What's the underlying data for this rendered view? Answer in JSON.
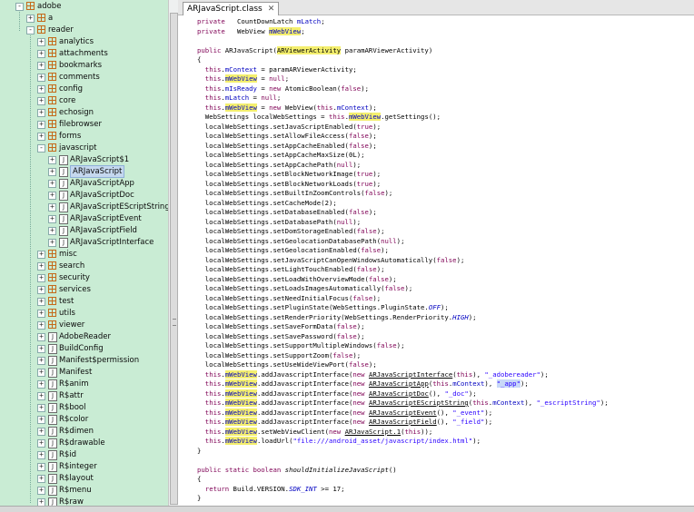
{
  "tree": {
    "items": [
      {
        "label": "adobe",
        "type": "pkg",
        "level": 0,
        "exp": "-"
      },
      {
        "label": "a",
        "type": "pkg",
        "level": 1,
        "exp": "+"
      },
      {
        "label": "reader",
        "type": "pkg",
        "level": 1,
        "exp": "-"
      },
      {
        "label": "analytics",
        "type": "pkg",
        "level": 2,
        "exp": "+"
      },
      {
        "label": "attachments",
        "type": "pkg",
        "level": 2,
        "exp": "+"
      },
      {
        "label": "bookmarks",
        "type": "pkg",
        "level": 2,
        "exp": "+"
      },
      {
        "label": "comments",
        "type": "pkg",
        "level": 2,
        "exp": "+"
      },
      {
        "label": "config",
        "type": "pkg",
        "level": 2,
        "exp": "+"
      },
      {
        "label": "core",
        "type": "pkg",
        "level": 2,
        "exp": "+"
      },
      {
        "label": "echosign",
        "type": "pkg",
        "level": 2,
        "exp": "+"
      },
      {
        "label": "filebrowser",
        "type": "pkg",
        "level": 2,
        "exp": "+"
      },
      {
        "label": "forms",
        "type": "pkg",
        "level": 2,
        "exp": "+"
      },
      {
        "label": "javascript",
        "type": "pkg",
        "level": 2,
        "exp": "-"
      },
      {
        "label": "ARJavaScript$1",
        "type": "cls",
        "level": 3,
        "exp": "+"
      },
      {
        "label": "ARJavaScript",
        "type": "cls",
        "level": 3,
        "exp": "+",
        "selected": true
      },
      {
        "label": "ARJavaScriptApp",
        "type": "cls",
        "level": 3,
        "exp": "+"
      },
      {
        "label": "ARJavaScriptDoc",
        "type": "cls",
        "level": 3,
        "exp": "+"
      },
      {
        "label": "ARJavaScriptEScriptString",
        "type": "cls",
        "level": 3,
        "exp": "+"
      },
      {
        "label": "ARJavaScriptEvent",
        "type": "cls",
        "level": 3,
        "exp": "+"
      },
      {
        "label": "ARJavaScriptField",
        "type": "cls",
        "level": 3,
        "exp": "+"
      },
      {
        "label": "ARJavaScriptInterface",
        "type": "cls",
        "level": 3,
        "exp": "+"
      },
      {
        "label": "misc",
        "type": "pkg",
        "level": 2,
        "exp": "+"
      },
      {
        "label": "search",
        "type": "pkg",
        "level": 2,
        "exp": "+"
      },
      {
        "label": "security",
        "type": "pkg",
        "level": 2,
        "exp": "+"
      },
      {
        "label": "services",
        "type": "pkg",
        "level": 2,
        "exp": "+"
      },
      {
        "label": "test",
        "type": "pkg",
        "level": 2,
        "exp": "+"
      },
      {
        "label": "utils",
        "type": "pkg",
        "level": 2,
        "exp": "+"
      },
      {
        "label": "viewer",
        "type": "pkg",
        "level": 2,
        "exp": "+"
      },
      {
        "label": "AdobeReader",
        "type": "cls",
        "level": 2,
        "exp": "+"
      },
      {
        "label": "BuildConfig",
        "type": "cls",
        "level": 2,
        "exp": "+"
      },
      {
        "label": "Manifest$permission",
        "type": "cls",
        "level": 2,
        "exp": "+"
      },
      {
        "label": "Manifest",
        "type": "cls",
        "level": 2,
        "exp": "+"
      },
      {
        "label": "R$anim",
        "type": "cls",
        "level": 2,
        "exp": "+"
      },
      {
        "label": "R$attr",
        "type": "cls",
        "level": 2,
        "exp": "+"
      },
      {
        "label": "R$bool",
        "type": "cls",
        "level": 2,
        "exp": "+"
      },
      {
        "label": "R$color",
        "type": "cls",
        "level": 2,
        "exp": "+"
      },
      {
        "label": "R$dimen",
        "type": "cls",
        "level": 2,
        "exp": "+"
      },
      {
        "label": "R$drawable",
        "type": "cls",
        "level": 2,
        "exp": "+"
      },
      {
        "label": "R$id",
        "type": "cls",
        "level": 2,
        "exp": "+"
      },
      {
        "label": "R$integer",
        "type": "cls",
        "level": 2,
        "exp": "+"
      },
      {
        "label": "R$layout",
        "type": "cls",
        "level": 2,
        "exp": "+"
      },
      {
        "label": "R$menu",
        "type": "cls",
        "level": 2,
        "exp": "+"
      },
      {
        "label": "R$raw",
        "type": "cls",
        "level": 2,
        "exp": "+"
      }
    ]
  },
  "editor": {
    "tab_title": "ARJavaScript.class",
    "close_glyph": "✕",
    "lines": [
      [
        [
          "kw",
          "private"
        ],
        [
          "",
          "   CountDownLatch "
        ],
        [
          "fld",
          "mLatch"
        ],
        [
          "",
          ";"
        ]
      ],
      [
        [
          "kw",
          "private"
        ],
        [
          "",
          "   WebView "
        ],
        [
          "fld hl",
          "mWebView"
        ],
        [
          "",
          ";"
        ]
      ],
      [],
      [
        [
          "kw",
          "public"
        ],
        [
          "",
          " ARJavaScript("
        ],
        [
          "hl",
          "ARViewerActivity"
        ],
        [
          "",
          " paramARViewerActivity)"
        ]
      ],
      [
        [
          "",
          "{"
        ]
      ],
      [
        [
          "",
          "  "
        ],
        [
          "kw",
          "this"
        ],
        [
          "",
          "."
        ],
        [
          "fld",
          "mContext"
        ],
        [
          "",
          " = paramARViewerActivity;"
        ]
      ],
      [
        [
          "",
          "  "
        ],
        [
          "kw",
          "this"
        ],
        [
          "",
          "."
        ],
        [
          "fld hl",
          "mWebView"
        ],
        [
          "",
          " = "
        ],
        [
          "kw",
          "null"
        ],
        [
          "",
          ";"
        ]
      ],
      [
        [
          "",
          "  "
        ],
        [
          "kw",
          "this"
        ],
        [
          "",
          "."
        ],
        [
          "fld",
          "mIsReady"
        ],
        [
          "",
          " = "
        ],
        [
          "kw",
          "new"
        ],
        [
          "",
          " AtomicBoolean("
        ],
        [
          "kw",
          "false"
        ],
        [
          "",
          ");"
        ]
      ],
      [
        [
          "",
          "  "
        ],
        [
          "kw",
          "this"
        ],
        [
          "",
          "."
        ],
        [
          "fld",
          "mLatch"
        ],
        [
          "",
          " = "
        ],
        [
          "kw",
          "null"
        ],
        [
          "",
          ";"
        ]
      ],
      [
        [
          "",
          "  "
        ],
        [
          "kw",
          "this"
        ],
        [
          "",
          "."
        ],
        [
          "fld hl",
          "mWebView"
        ],
        [
          "",
          " = "
        ],
        [
          "kw",
          "new"
        ],
        [
          "",
          " WebView("
        ],
        [
          "kw",
          "this"
        ],
        [
          "",
          "."
        ],
        [
          "fld",
          "mContext"
        ],
        [
          "",
          ");"
        ]
      ],
      [
        [
          "",
          "  WebSettings localWebSettings = "
        ],
        [
          "kw",
          "this"
        ],
        [
          "",
          "."
        ],
        [
          "fld hl",
          "mWebView"
        ],
        [
          "",
          ".getSettings();"
        ]
      ],
      [
        [
          "",
          "  localWebSettings.setJavaScriptEnabled("
        ],
        [
          "kw",
          "true"
        ],
        [
          "",
          ");"
        ]
      ],
      [
        [
          "",
          "  localWebSettings.setAllowFileAccess("
        ],
        [
          "kw",
          "false"
        ],
        [
          "",
          ");"
        ]
      ],
      [
        [
          "",
          "  localWebSettings.setAppCacheEnabled("
        ],
        [
          "kw",
          "false"
        ],
        [
          "",
          ");"
        ]
      ],
      [
        [
          "",
          "  localWebSettings.setAppCacheMaxSize(0L);"
        ]
      ],
      [
        [
          "",
          "  localWebSettings.setAppCachePath("
        ],
        [
          "kw",
          "null"
        ],
        [
          "",
          ");"
        ]
      ],
      [
        [
          "",
          "  localWebSettings.setBlockNetworkImage("
        ],
        [
          "kw",
          "true"
        ],
        [
          "",
          ");"
        ]
      ],
      [
        [
          "",
          "  localWebSettings.setBlockNetworkLoads("
        ],
        [
          "kw",
          "true"
        ],
        [
          "",
          ");"
        ]
      ],
      [
        [
          "",
          "  localWebSettings.setBuiltInZoomControls("
        ],
        [
          "kw",
          "false"
        ],
        [
          "",
          ");"
        ]
      ],
      [
        [
          "",
          "  localWebSettings.setCacheMode(2);"
        ]
      ],
      [
        [
          "",
          "  localWebSettings.setDatabaseEnabled("
        ],
        [
          "kw",
          "false"
        ],
        [
          "",
          ");"
        ]
      ],
      [
        [
          "",
          "  localWebSettings.setDatabasePath("
        ],
        [
          "kw",
          "null"
        ],
        [
          "",
          ");"
        ]
      ],
      [
        [
          "",
          "  localWebSettings.setDomStorageEnabled("
        ],
        [
          "kw",
          "false"
        ],
        [
          "",
          ");"
        ]
      ],
      [
        [
          "",
          "  localWebSettings.setGeolocationDatabasePath("
        ],
        [
          "kw",
          "null"
        ],
        [
          "",
          ");"
        ]
      ],
      [
        [
          "",
          "  localWebSettings.setGeolocationEnabled("
        ],
        [
          "kw",
          "false"
        ],
        [
          "",
          ");"
        ]
      ],
      [
        [
          "",
          "  localWebSettings.setJavaScriptCanOpenWindowsAutomatically("
        ],
        [
          "kw",
          "false"
        ],
        [
          "",
          ");"
        ]
      ],
      [
        [
          "",
          "  localWebSettings.setLightTouchEnabled("
        ],
        [
          "kw",
          "false"
        ],
        [
          "",
          ");"
        ]
      ],
      [
        [
          "",
          "  localWebSettings.setLoadWithOverviewMode("
        ],
        [
          "kw",
          "false"
        ],
        [
          "",
          ");"
        ]
      ],
      [
        [
          "",
          "  localWebSettings.setLoadsImagesAutomatically("
        ],
        [
          "kw",
          "false"
        ],
        [
          "",
          ");"
        ]
      ],
      [
        [
          "",
          "  localWebSettings.setNeedInitialFocus("
        ],
        [
          "kw",
          "false"
        ],
        [
          "",
          ");"
        ]
      ],
      [
        [
          "",
          "  localWebSettings.setPluginState(WebSettings.PluginState."
        ],
        [
          "sta",
          "OFF"
        ],
        [
          "",
          ");"
        ]
      ],
      [
        [
          "",
          "  localWebSettings.setRenderPriority(WebSettings.RenderPriority."
        ],
        [
          "sta",
          "HIGH"
        ],
        [
          "",
          ");"
        ]
      ],
      [
        [
          "",
          "  localWebSettings.setSaveFormData("
        ],
        [
          "kw",
          "false"
        ],
        [
          "",
          ");"
        ]
      ],
      [
        [
          "",
          "  localWebSettings.setSavePassword("
        ],
        [
          "kw",
          "false"
        ],
        [
          "",
          ");"
        ]
      ],
      [
        [
          "",
          "  localWebSettings.setSupportMultipleWindows("
        ],
        [
          "kw",
          "false"
        ],
        [
          "",
          ");"
        ]
      ],
      [
        [
          "",
          "  localWebSettings.setSupportZoom("
        ],
        [
          "kw",
          "false"
        ],
        [
          "",
          ");"
        ]
      ],
      [
        [
          "",
          "  localWebSettings.setUseWideViewPort("
        ],
        [
          "kw",
          "false"
        ],
        [
          "",
          ");"
        ]
      ],
      [
        [
          "",
          "  "
        ],
        [
          "kw",
          "this"
        ],
        [
          "",
          "."
        ],
        [
          "fld hl",
          "mWebView"
        ],
        [
          "",
          ".addJavascriptInterface("
        ],
        [
          "kw",
          "new"
        ],
        [
          "",
          " "
        ],
        [
          "ul",
          "ARJavaScriptInterface"
        ],
        [
          "",
          "("
        ],
        [
          "kw",
          "this"
        ],
        [
          "",
          "), "
        ],
        [
          "st",
          "\"_adobereader\""
        ],
        [
          "",
          ");"
        ]
      ],
      [
        [
          "",
          "  "
        ],
        [
          "kw",
          "this"
        ],
        [
          "",
          "."
        ],
        [
          "fld hl",
          "mWebView"
        ],
        [
          "",
          ".addJavascriptInterface("
        ],
        [
          "kw",
          "new"
        ],
        [
          "",
          " "
        ],
        [
          "ul",
          "ARJavaScriptApp"
        ],
        [
          "",
          "("
        ],
        [
          "kw",
          "this"
        ],
        [
          "",
          "."
        ],
        [
          "fld",
          "mContext"
        ],
        [
          "",
          "), "
        ],
        [
          "st hlsel",
          "\"_app\""
        ],
        [
          "",
          ");"
        ]
      ],
      [
        [
          "",
          "  "
        ],
        [
          "kw",
          "this"
        ],
        [
          "",
          "."
        ],
        [
          "fld hl",
          "mWebView"
        ],
        [
          "",
          ".addJavascriptInterface("
        ],
        [
          "kw",
          "new"
        ],
        [
          "",
          " "
        ],
        [
          "ul",
          "ARJavaScriptDoc"
        ],
        [
          "",
          "(), "
        ],
        [
          "st",
          "\"_doc\""
        ],
        [
          "",
          ");"
        ]
      ],
      [
        [
          "",
          "  "
        ],
        [
          "kw",
          "this"
        ],
        [
          "",
          "."
        ],
        [
          "fld hl",
          "mWebView"
        ],
        [
          "",
          ".addJavascriptInterface("
        ],
        [
          "kw",
          "new"
        ],
        [
          "",
          " "
        ],
        [
          "ul",
          "ARJavaScriptEScriptString"
        ],
        [
          "",
          "("
        ],
        [
          "kw",
          "this"
        ],
        [
          "",
          "."
        ],
        [
          "fld",
          "mContext"
        ],
        [
          "",
          "), "
        ],
        [
          "st",
          "\"_escriptString\""
        ],
        [
          "",
          ");"
        ]
      ],
      [
        [
          "",
          "  "
        ],
        [
          "kw",
          "this"
        ],
        [
          "",
          "."
        ],
        [
          "fld hl",
          "mWebView"
        ],
        [
          "",
          ".addJavascriptInterface("
        ],
        [
          "kw",
          "new"
        ],
        [
          "",
          " "
        ],
        [
          "ul",
          "ARJavaScriptEvent"
        ],
        [
          "",
          "(), "
        ],
        [
          "st",
          "\"_event\""
        ],
        [
          "",
          ");"
        ]
      ],
      [
        [
          "",
          "  "
        ],
        [
          "kw",
          "this"
        ],
        [
          "",
          "."
        ],
        [
          "fld hl",
          "mWebView"
        ],
        [
          "",
          ".addJavascriptInterface("
        ],
        [
          "kw",
          "new"
        ],
        [
          "",
          " "
        ],
        [
          "ul",
          "ARJavaScriptField"
        ],
        [
          "",
          "(), "
        ],
        [
          "st",
          "\"_field\""
        ],
        [
          "",
          ");"
        ]
      ],
      [
        [
          "",
          "  "
        ],
        [
          "kw",
          "this"
        ],
        [
          "",
          "."
        ],
        [
          "fld hl",
          "mWebView"
        ],
        [
          "",
          ".setWebViewClient("
        ],
        [
          "kw",
          "new"
        ],
        [
          "",
          " "
        ],
        [
          "ul",
          "ARJavaScript.1"
        ],
        [
          "",
          "("
        ],
        [
          "kw",
          "this"
        ],
        [
          "",
          "));"
        ]
      ],
      [
        [
          "",
          "  "
        ],
        [
          "kw",
          "this"
        ],
        [
          "",
          "."
        ],
        [
          "fld hl",
          "mWebView"
        ],
        [
          "",
          ".loadUrl("
        ],
        [
          "st",
          "\"file:///android_asset/javascript/index.html\""
        ],
        [
          "",
          ");"
        ]
      ],
      [
        [
          "",
          "}"
        ]
      ],
      [],
      [
        [
          "kw",
          "public static boolean"
        ],
        [
          "",
          " "
        ],
        [
          "mi",
          "shouldInitializeJavaScript"
        ],
        [
          "",
          "()"
        ]
      ],
      [
        [
          "",
          "{"
        ]
      ],
      [
        [
          "",
          "  "
        ],
        [
          "kw",
          "return"
        ],
        [
          "",
          " Build.VERSION."
        ],
        [
          "sta",
          "SDK_INT"
        ],
        [
          "",
          " >= 17;"
        ]
      ],
      [
        [
          "",
          "}"
        ]
      ]
    ]
  }
}
